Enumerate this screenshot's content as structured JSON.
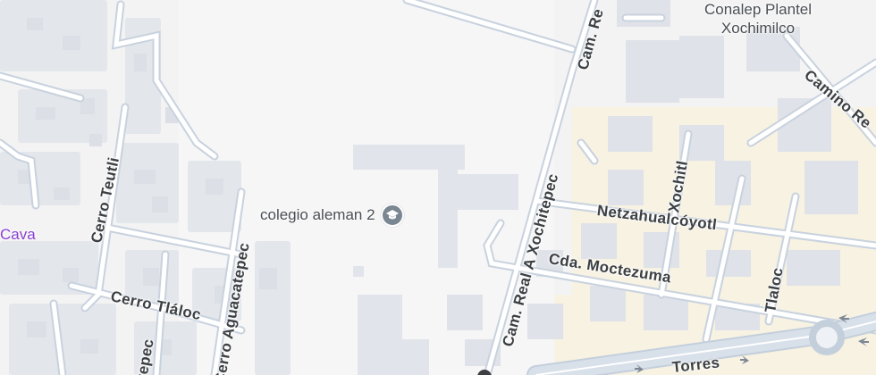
{
  "map": {
    "colors": {
      "background": "#f3f3f4",
      "block": "#e6e8ec",
      "building": "#dfe2e8",
      "street": "#ffffff",
      "street_edge": "#c6d0dc",
      "major_road": "#d3dbe6",
      "commercial": "#f8f1dd",
      "poi_icon": "#7a8793",
      "place_label": "#8b3fd1"
    },
    "street_labels": {
      "cam_real_top": "Cam. Re",
      "conalep_line1": "Conalep Plantel",
      "conalep_line2": "Xochimilco",
      "camino_real": "Camino Re",
      "cerro_teutli": "Cerro Teutli",
      "xochitl": "Xochitl",
      "cam_real_xochitepec": "Cam. Real A Xochitepec",
      "netzahualcoyotl": "Netzahualcóyotl",
      "cda_moctezuma": "Cda. Moctezuma",
      "tlaloc": "Tlaloc",
      "cerro_tlaloc": "Cerro Tláloc",
      "cerro_aguacatepec": "Cerro Aguacatepec",
      "xochitepec_partial": "itepec",
      "torres": "Torres"
    },
    "poi": {
      "name": "colegio aleman 2",
      "icon": "graduation-cap-icon"
    },
    "place_label": "Cava"
  }
}
